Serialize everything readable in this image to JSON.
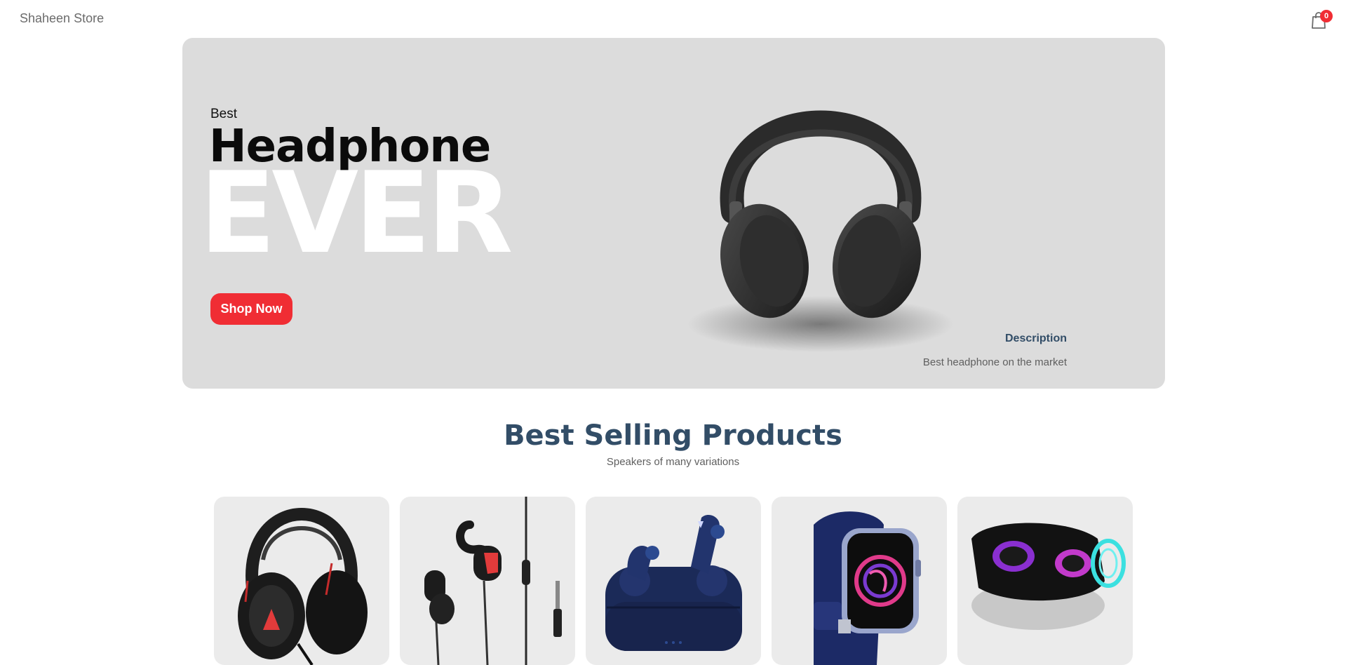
{
  "navbar": {
    "logo": "Shaheen Store",
    "cart_count": "0",
    "cart_icon": "shopping-bag-icon"
  },
  "hero": {
    "small_text": "Best",
    "mid_text": "Headphone",
    "large_text": "EVER",
    "button_label": "Shop Now",
    "desc_title": "Description",
    "desc_text": "Best headphone on the market",
    "image": "headphone-image"
  },
  "best_selling": {
    "title": "Best Selling Products",
    "subtitle": "Speakers of many variations"
  },
  "products": [
    {
      "image": "over-ear-headphone-image"
    },
    {
      "image": "wired-earphone-image"
    },
    {
      "image": "wireless-earbuds-image"
    },
    {
      "image": "smartwatch-image"
    },
    {
      "image": "bluetooth-speaker-image"
    }
  ],
  "colors": {
    "accent": "#f02d34",
    "heading": "#324d67",
    "hero_bg": "#dcdcdc",
    "card_bg": "#ebebeb"
  }
}
